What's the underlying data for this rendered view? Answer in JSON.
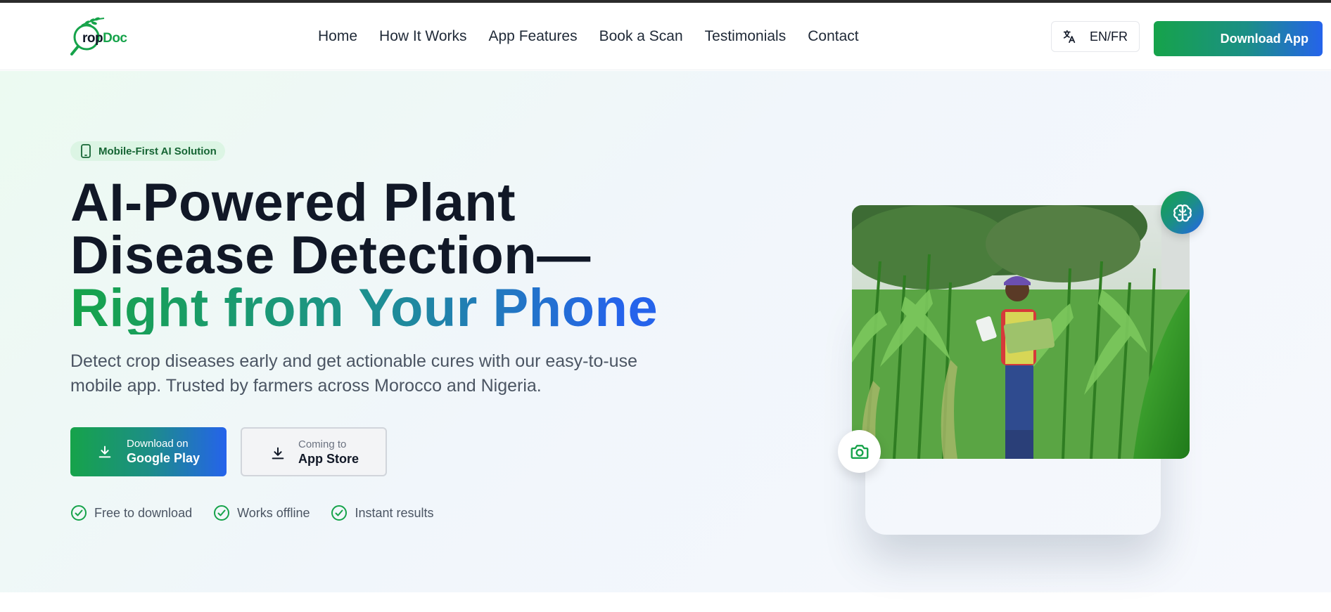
{
  "brand": {
    "logo_part1": "rop",
    "logo_part2": "Doc"
  },
  "nav": {
    "items": [
      "Home",
      "How It Works",
      "App Features",
      "Book a Scan",
      "Testimonials",
      "Contact"
    ]
  },
  "header": {
    "lang_label": "EN/FR",
    "download_app_label": "Download App"
  },
  "hero": {
    "badge": "Mobile-First AI Solution",
    "title_line1": "AI-Powered Plant",
    "title_line2": "Disease Detection—",
    "title_line3": "Right from Your Phone",
    "subtitle": "Detect crop diseases early and get actionable cures with our easy-to-use mobile app. Trusted by farmers across Morocco and Nigeria.",
    "google_play": {
      "small": "Download on",
      "big": "Google Play"
    },
    "app_store": {
      "small": "Coming to",
      "big": "App Store"
    },
    "features": [
      "Free to download",
      "Works offline",
      "Instant results"
    ]
  },
  "colors": {
    "brand_green": "#16a34a",
    "brand_blue": "#2563eb",
    "dark_text": "#111827"
  },
  "icons": {
    "language": "translate-icon",
    "badge": "smartphone-icon",
    "download": "download-icon",
    "feature": "check-circle-icon",
    "brain": "brain-icon",
    "camera": "camera-icon"
  }
}
